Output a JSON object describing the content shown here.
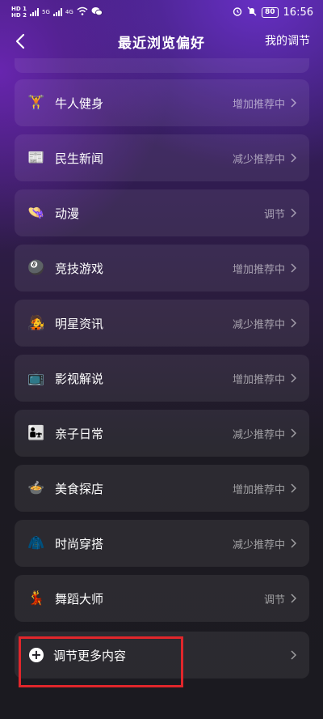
{
  "status_bar": {
    "left_top": "HD 1",
    "left_bottom": "HD 2",
    "net_1": "5G",
    "net_2": "4G",
    "battery": "80",
    "time": "16:56"
  },
  "header": {
    "title": "最近浏览偏好",
    "right_link": "我的调节"
  },
  "items": [
    {
      "emoji": "🏋",
      "label": "牛人健身",
      "status": "增加推荐中"
    },
    {
      "emoji": "📰",
      "label": "民生新闻",
      "status": "减少推荐中"
    },
    {
      "emoji": "👒",
      "label": "动漫",
      "status": "调节"
    },
    {
      "emoji": "🎱",
      "label": "竞技游戏",
      "status": "增加推荐中"
    },
    {
      "emoji": "🧑‍🎤",
      "label": "明星资讯",
      "status": "减少推荐中"
    },
    {
      "emoji": "📺",
      "label": "影视解说",
      "status": "增加推荐中"
    },
    {
      "emoji": "👨‍👧",
      "label": "亲子日常",
      "status": "减少推荐中"
    },
    {
      "emoji": "🍲",
      "label": "美食探店",
      "status": "增加推荐中"
    },
    {
      "emoji": "🧥",
      "label": "时尚穿搭",
      "status": "减少推荐中"
    },
    {
      "emoji": "💃",
      "label": "舞蹈大师",
      "status": "调节"
    }
  ],
  "more": {
    "label": "调节更多内容"
  },
  "colors": {
    "accent_purple": "#6e32d2",
    "highlight_red": "#e0262b"
  }
}
